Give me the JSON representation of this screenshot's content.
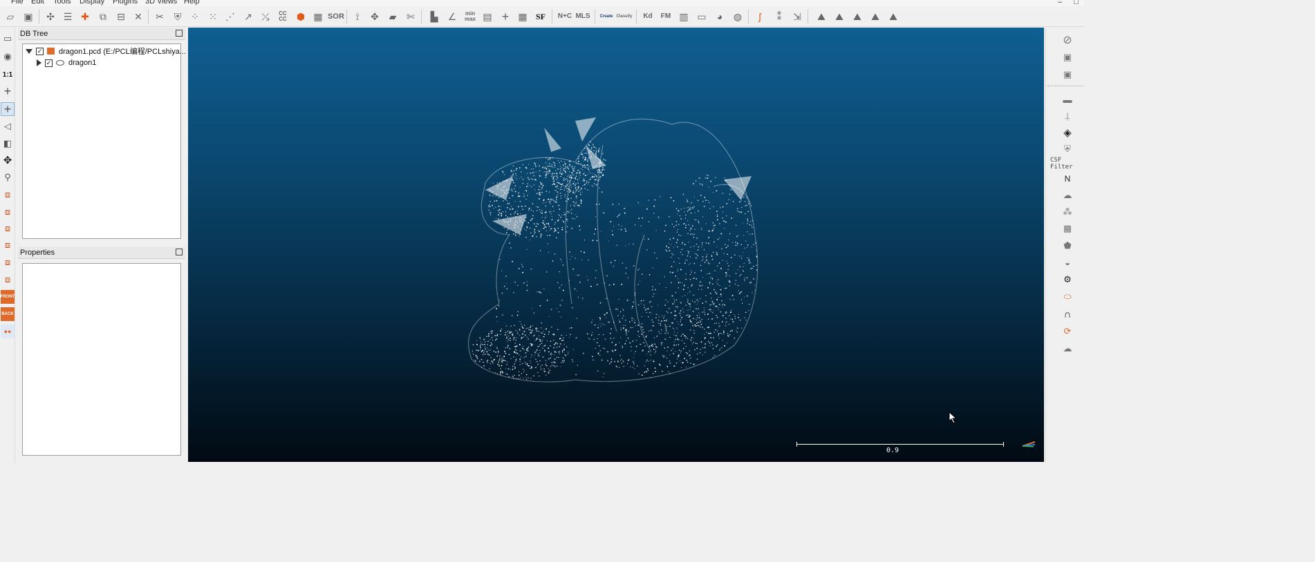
{
  "menu": {
    "items": [
      "File",
      "Edit",
      "Tools",
      "Display",
      "Plugins",
      "3D Views",
      "Help"
    ]
  },
  "window_controls": {
    "minimize": "–",
    "maximize": "□"
  },
  "toolbar": {
    "icons": [
      {
        "name": "open-icon",
        "glyph": "▱"
      },
      {
        "name": "save-icon",
        "glyph": "▣"
      },
      {
        "name": "picking-icon",
        "glyph": "✣"
      },
      {
        "name": "list-icon",
        "glyph": "☰"
      },
      {
        "name": "add-point-icon",
        "glyph": "✚"
      },
      {
        "name": "clone-icon",
        "glyph": "⧉"
      },
      {
        "name": "merge-icon",
        "glyph": "⊟"
      },
      {
        "name": "delete-icon",
        "glyph": "✕"
      },
      {
        "name": "segment-icon",
        "glyph": "✂"
      },
      {
        "name": "shield-icon",
        "glyph": "⛨"
      },
      {
        "name": "subsample-icon",
        "glyph": "⁘"
      },
      {
        "name": "octree-icon",
        "glyph": "⁙"
      },
      {
        "name": "align-icon",
        "glyph": "⋰"
      },
      {
        "name": "register-icon",
        "glyph": "↗"
      },
      {
        "name": "fine-register-icon",
        "glyph": "⤯"
      },
      {
        "name": "cc-icon",
        "label": "CC CC"
      },
      {
        "name": "mesh-icon",
        "glyph": "⬢"
      },
      {
        "name": "checker-icon",
        "glyph": "▦"
      },
      {
        "name": "sor-icon",
        "label": "SOR"
      },
      {
        "name": "branch-icon",
        "glyph": "⟟"
      },
      {
        "name": "translate-icon",
        "glyph": "✥"
      },
      {
        "name": "plane-icon",
        "glyph": "▰"
      },
      {
        "name": "scissors-icon",
        "glyph": "✄"
      },
      {
        "name": "histogram-icon",
        "glyph": "▙"
      },
      {
        "name": "gradient-icon",
        "glyph": "∠"
      },
      {
        "name": "minmax-icon",
        "label": "min max"
      },
      {
        "name": "table-icon",
        "glyph": "▤"
      },
      {
        "name": "plus-icon",
        "glyph": "+"
      },
      {
        "name": "calculator-icon",
        "glyph": "▦"
      },
      {
        "name": "sf-icon",
        "label": "SF"
      },
      {
        "name": "normals-icon",
        "label": "N+C"
      },
      {
        "name": "mls-icon",
        "label": "MLS"
      },
      {
        "name": "canupo-create-icon",
        "label": "Create"
      },
      {
        "name": "canupo-classify-icon",
        "label": "Classify"
      },
      {
        "name": "kd-icon",
        "label": "Kd"
      },
      {
        "name": "fm-icon",
        "label": "FM"
      },
      {
        "name": "grid-icon",
        "glyph": "▥"
      },
      {
        "name": "box-icon",
        "glyph": "▭"
      },
      {
        "name": "sphere-icon",
        "glyph": "◕"
      },
      {
        "name": "globe-icon",
        "glyph": "◍"
      },
      {
        "name": "curve-icon",
        "glyph": "ʃ"
      },
      {
        "name": "scatter-icon",
        "glyph": "⁑"
      },
      {
        "name": "export-icon",
        "glyph": "⇲"
      },
      {
        "name": "mountain1-icon",
        "glyph": "⛰"
      },
      {
        "name": "mountain2-icon",
        "glyph": "⛰"
      },
      {
        "name": "mountain3-icon",
        "glyph": "⛰"
      },
      {
        "name": "mountain4-icon",
        "glyph": "⛰"
      },
      {
        "name": "mountain5-icon",
        "glyph": "⛰"
      }
    ]
  },
  "left_tools": [
    {
      "name": "display-icon",
      "glyph": "▭"
    },
    {
      "name": "camera-icon",
      "glyph": "◉"
    },
    {
      "name": "zoom-1to1-icon",
      "glyph": "1:1"
    },
    {
      "name": "pivot-icon",
      "glyph": "+"
    },
    {
      "name": "pivot-auto-icon",
      "glyph": "+"
    },
    {
      "name": "perspective-icon",
      "glyph": "◁"
    },
    {
      "name": "view-mode-icon",
      "glyph": "◧"
    },
    {
      "name": "move-icon",
      "glyph": "✥"
    },
    {
      "name": "zoom-icon",
      "glyph": "⚲"
    },
    {
      "name": "top-view-icon",
      "glyph": "⧈"
    },
    {
      "name": "front-view-icon",
      "glyph": "⧈"
    },
    {
      "name": "left-view-icon",
      "glyph": "⧈"
    },
    {
      "name": "back-view-icon",
      "glyph": "⧈"
    },
    {
      "name": "right-view-icon",
      "glyph": "⧈"
    },
    {
      "name": "bottom-view-icon",
      "glyph": "⧈"
    },
    {
      "name": "front-iso-icon",
      "label": "FRONT"
    },
    {
      "name": "back-iso-icon",
      "label": "BACK"
    },
    {
      "name": "stereo-icon",
      "glyph": "●●"
    }
  ],
  "db_tree": {
    "title": "DB Tree",
    "items": [
      {
        "label": "dragon1.pcd (E:/PCL编程/PCLshiya..."
      },
      {
        "label": "dragon1"
      }
    ]
  },
  "properties": {
    "title": "Properties"
  },
  "viewport": {
    "scale_label": "0.9",
    "colors": {
      "top": "#0f5f92",
      "bottom": "#010a12",
      "points": "#ffffff"
    }
  },
  "right_tools": [
    {
      "name": "disable-icon",
      "glyph": "⊘"
    },
    {
      "name": "cdl-icon",
      "glyph": "▣"
    },
    {
      "name": "sss-icon",
      "glyph": "▣"
    },
    {
      "name": "clapper-icon",
      "glyph": "▬"
    },
    {
      "name": "brush-icon",
      "glyph": "⍊"
    },
    {
      "name": "compass-icon",
      "glyph": "◈"
    },
    {
      "name": "shield2-icon",
      "glyph": "⛨"
    },
    {
      "name": "csf-filter-label",
      "label": "CSF Filter"
    },
    {
      "name": "north-icon",
      "label": "N"
    },
    {
      "name": "hpr-icon",
      "glyph": "☁"
    },
    {
      "name": "m3c2-icon",
      "glyph": "⁂"
    },
    {
      "name": "pcv-icon",
      "glyph": "▦"
    },
    {
      "name": "polygon-icon",
      "glyph": "⬟"
    },
    {
      "name": "rsd-icon",
      "glyph": "◒"
    },
    {
      "name": "gear-icon",
      "glyph": "⚙"
    },
    {
      "name": "ellipse-icon",
      "glyph": "⬭"
    },
    {
      "name": "arch-icon",
      "glyph": "∩"
    },
    {
      "name": "animation-icon",
      "glyph": "⟳"
    },
    {
      "name": "cloud-export-icon",
      "glyph": "☁"
    }
  ]
}
